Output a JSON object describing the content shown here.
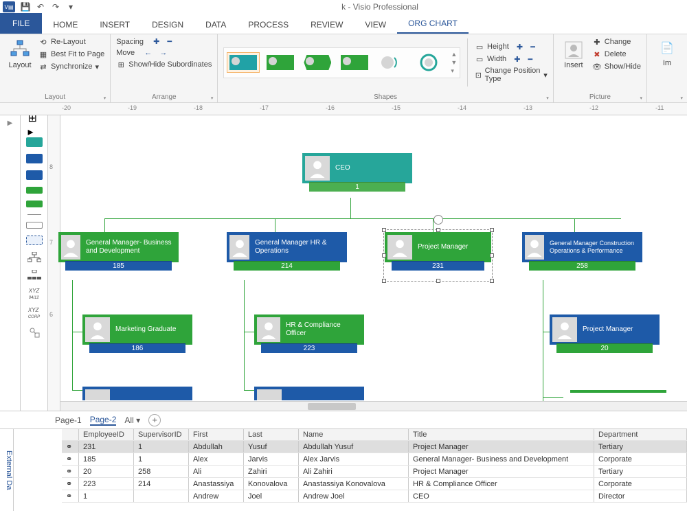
{
  "app": {
    "title_suffix": "k - Visio Professional"
  },
  "tabs": [
    "FILE",
    "HOME",
    "INSERT",
    "DESIGN",
    "DATA",
    "PROCESS",
    "REVIEW",
    "VIEW",
    "ORG CHART"
  ],
  "active_tab": "ORG CHART",
  "ribbon": {
    "layout": {
      "label": "Layout",
      "btn": "Layout",
      "relayout": "Re-Layout",
      "bestfit": "Best Fit to Page",
      "sync": "Synchronize"
    },
    "arrange": {
      "label": "Arrange",
      "spacing": "Spacing",
      "move": "Move",
      "showhide": "Show/Hide Subordinates"
    },
    "shapes": {
      "label": "Shapes",
      "height": "Height",
      "width": "Width",
      "changepos": "Change Position Type"
    },
    "picture": {
      "label": "Picture",
      "insert": "Insert",
      "change": "Change",
      "delete": "Delete",
      "showhide": "Show/Hide"
    },
    "import": {
      "im": "Im"
    }
  },
  "ruler_marks": [
    "-20",
    "-19",
    "-18",
    "-17",
    "-16",
    "-15",
    "-14",
    "-13",
    "-12",
    "-11"
  ],
  "vruler_marks": [
    "8",
    "7",
    "6"
  ],
  "orgchart": {
    "ceo": {
      "title": "CEO",
      "id": "1"
    },
    "gm_bus": {
      "title": "General Manager- Business and Development",
      "id": "185"
    },
    "gm_hr": {
      "title": "General Manager HR & Operations",
      "id": "214"
    },
    "pm": {
      "title": "Project Manager",
      "id": "231"
    },
    "gm_con": {
      "title": "General Manager Construction Operations & Performance",
      "id": "258"
    },
    "mkt": {
      "title": "Marketing Graduate",
      "id": "186"
    },
    "hrc": {
      "title": "HR & Compliance Officer",
      "id": "223"
    },
    "pm2": {
      "title": "Project Manager",
      "id": "20"
    }
  },
  "pages": {
    "p1": "Page-1",
    "p2": "Page-2",
    "all": "All"
  },
  "extdata": {
    "label": "External Da",
    "headers": [
      "",
      "EmployeeID",
      "SupervisorID",
      "First",
      "Last",
      "Name",
      "Title",
      "Department"
    ],
    "rows": [
      {
        "link": "⚭",
        "emp": "231",
        "sup": "1",
        "first": "Abdullah",
        "last": "Yusuf",
        "name": "Abdullah Yusuf",
        "title": "Project Manager",
        "dept": "Tertiary"
      },
      {
        "link": "⚭",
        "emp": "185",
        "sup": "1",
        "first": "Alex",
        "last": "Jarvis",
        "name": "Alex Jarvis",
        "title": "General Manager- Business and Development",
        "dept": "Corporate"
      },
      {
        "link": "⚭",
        "emp": "20",
        "sup": "258",
        "first": "Ali",
        "last": "Zahiri",
        "name": "Ali Zahiri",
        "title": "Project Manager",
        "dept": "Tertiary"
      },
      {
        "link": "⚭",
        "emp": "223",
        "sup": "214",
        "first": "Anastassiya",
        "last": "Konovalova",
        "name": "Anastassiya Konovalova",
        "title": "HR & Compliance Officer",
        "dept": "Corporate"
      },
      {
        "link": "⚭",
        "emp": "1",
        "sup": "",
        "first": "Andrew",
        "last": "Joel",
        "name": "Andrew Joel",
        "title": "CEO",
        "dept": "Director"
      }
    ]
  }
}
